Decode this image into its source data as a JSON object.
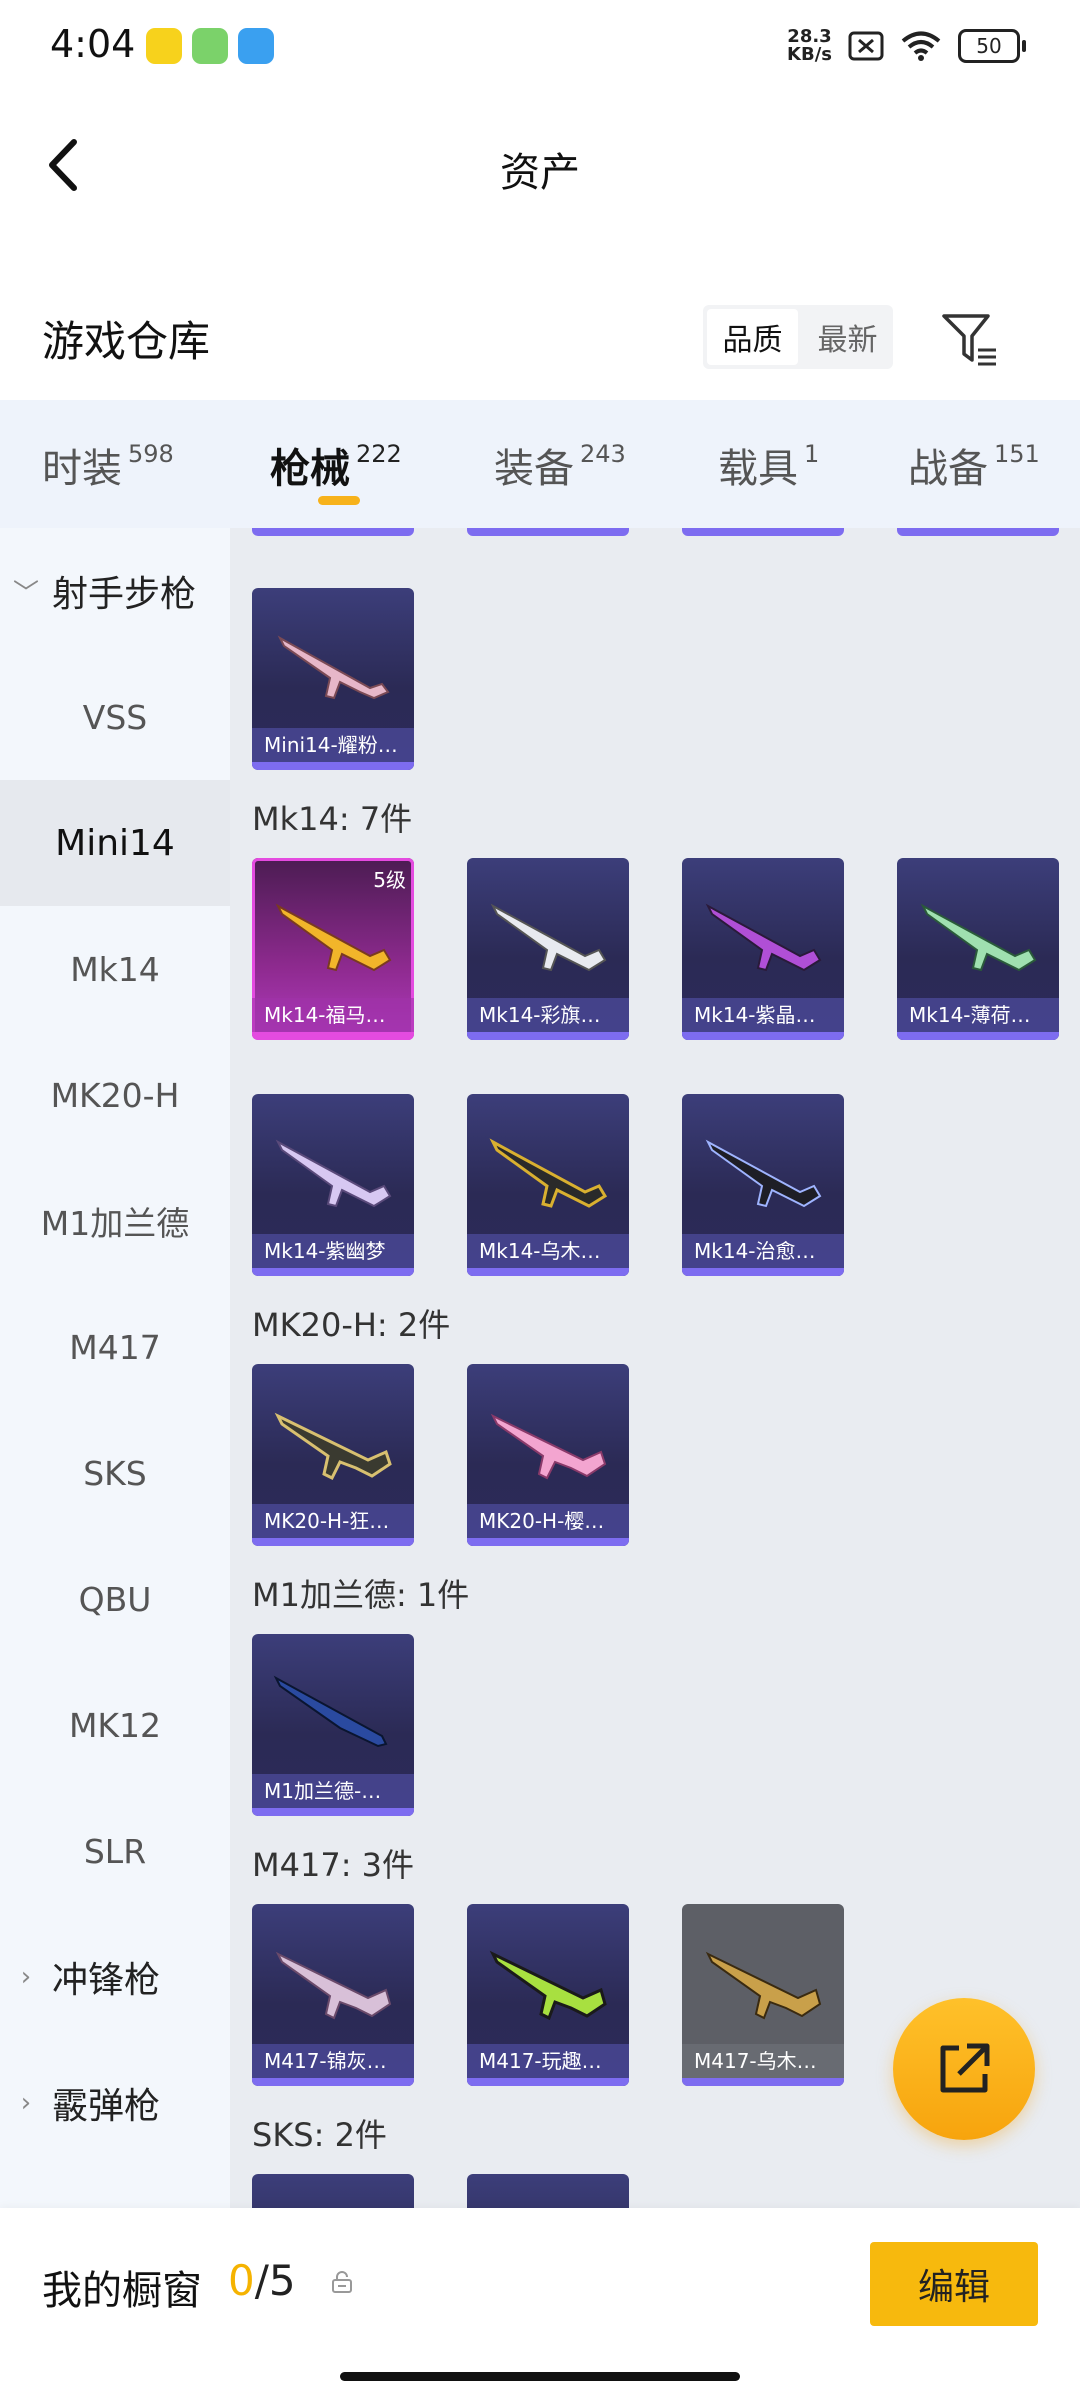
{
  "status_bar": {
    "time": "4:04",
    "net_speed_value": "28.3",
    "net_speed_unit": "KB/s",
    "battery": "50"
  },
  "nav": {
    "title": "资产"
  },
  "warehouse": {
    "title": "游戏仓库",
    "sort_quality": "品质",
    "sort_latest": "最新"
  },
  "tabs": [
    {
      "label": "时装",
      "count": "598"
    },
    {
      "label": "枪械",
      "count": "222"
    },
    {
      "label": "装备",
      "count": "243"
    },
    {
      "label": "载具",
      "count": "1"
    },
    {
      "label": "战备",
      "count": "151"
    }
  ],
  "sidebar": {
    "group_rifle": "射手步枪",
    "items": [
      "VSS",
      "Mini14",
      "Mk14",
      "MK20-H",
      "M1加兰德",
      "M417",
      "SKS",
      "QBU",
      "MK12",
      "SLR"
    ],
    "group_smg": "冲锋枪",
    "group_shotgun": "霰弹枪"
  },
  "sections": {
    "mini14_items": [
      "Mini14-耀粉…"
    ],
    "mk14_header": "Mk14: 7件",
    "mk14_level": "5级",
    "mk14_items": [
      "Mk14-福马…",
      "Mk14-彩旗…",
      "Mk14-紫晶…",
      "Mk14-薄荷…",
      "Mk14-紫幽梦",
      "Mk14-乌木…",
      "Mk14-治愈…"
    ],
    "mk20_header": "MK20-H: 2件",
    "mk20_items": [
      "MK20-H-狂…",
      "MK20-H-樱…"
    ],
    "m1_header": "M1加兰德: 1件",
    "m1_items": [
      "M1加兰德-…"
    ],
    "m417_header": "M417: 3件",
    "m417_items": [
      "M417-锦灰…",
      "M417-玩趣…",
      "M417-乌木…"
    ],
    "sks_header": "SKS: 2件"
  },
  "bottom": {
    "label": "我的橱窗",
    "current": "0",
    "slash": "/",
    "max": "5",
    "edit": "编辑"
  },
  "colors": {
    "accent": "#f7b90d",
    "card_purple": "#2b2a55",
    "card_pink": "#b03bbd",
    "card_grey": "#5d5f66"
  }
}
